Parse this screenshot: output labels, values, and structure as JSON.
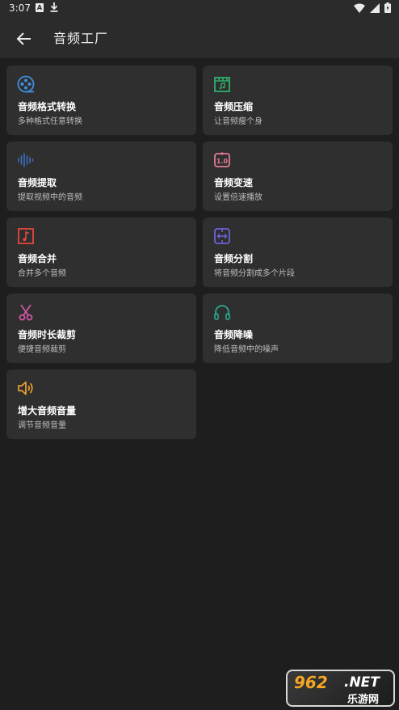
{
  "status_bar": {
    "time": "3:07",
    "a_badge": "A"
  },
  "header": {
    "title": "音频工厂"
  },
  "cards": [
    {
      "label": "音频格式转换",
      "desc": "多种格式任意转换",
      "icon": "film-reel-icon",
      "color": "#3d8fe0"
    },
    {
      "label": "音频压缩",
      "desc": "让音频瘦个身",
      "icon": "clapperboard-music-icon",
      "color": "#2fae6a"
    },
    {
      "label": "音频提取",
      "desc": "提取视频中的音频",
      "icon": "waveform-icon",
      "color": "#3d6fc0"
    },
    {
      "label": "音频变速",
      "desc": "设置倍速播放",
      "icon": "speed-icon",
      "color": "#e07a94"
    },
    {
      "label": "音频合并",
      "desc": "合并多个音频",
      "icon": "music-file-icon",
      "color": "#e5473f"
    },
    {
      "label": "音频分割",
      "desc": "将音频分割成多个片段",
      "icon": "split-icon",
      "color": "#6a63d9"
    },
    {
      "label": "音频时长裁剪",
      "desc": "便捷音频裁剪",
      "icon": "scissors-icon",
      "color": "#d657a8"
    },
    {
      "label": "音频降噪",
      "desc": "降低音频中的噪声",
      "icon": "headphones-icon",
      "color": "#2aa78f"
    },
    {
      "label": "增大音频音量",
      "desc": "调节音频音量",
      "icon": "speaker-icon",
      "color": "#f2a12e"
    }
  ],
  "watermark": {
    "number": "962",
    "net": ".NET",
    "sub": "乐游网"
  }
}
